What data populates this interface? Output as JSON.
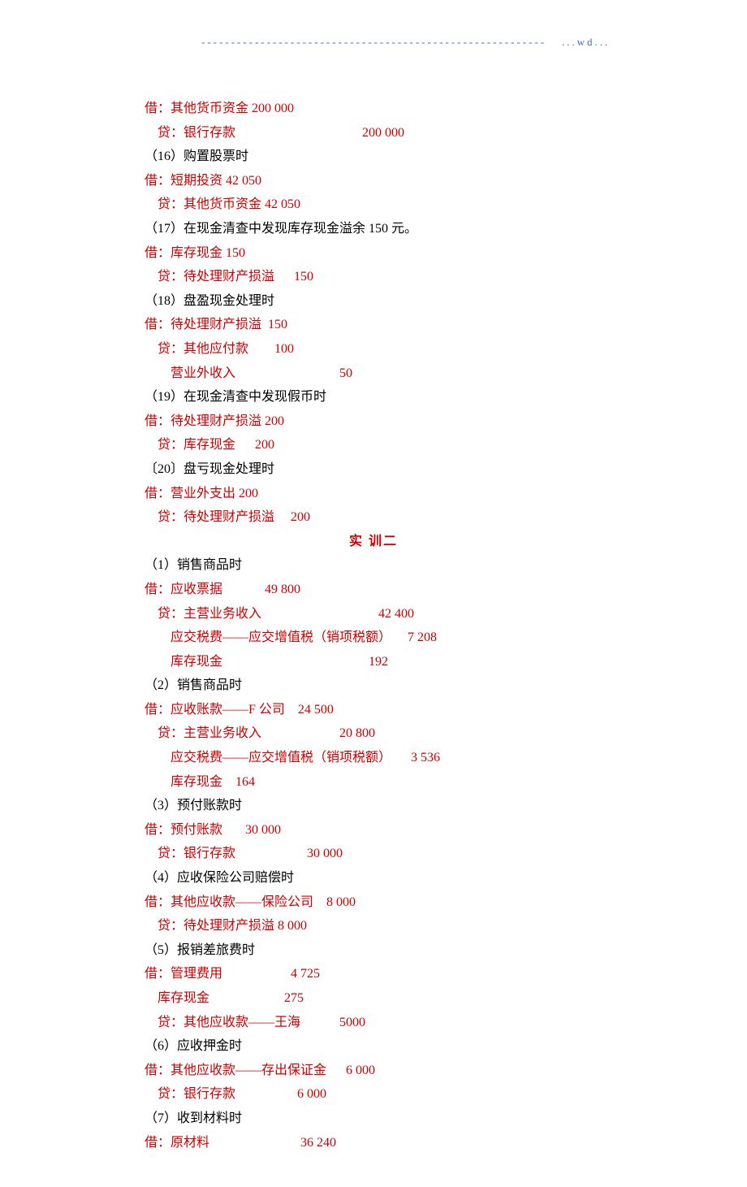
{
  "header": "----------------------------------------------------------   ...wd...",
  "lines": [
    {
      "cls": "line",
      "text": "借：其他货币资金 200 000"
    },
    {
      "cls": "line",
      "text": "    贷：银行存款                                       200 000"
    },
    {
      "cls": "line black",
      "text": "（16）购置股票时"
    },
    {
      "cls": "line",
      "text": "借：短期投资 42 050"
    },
    {
      "cls": "line",
      "text": "    贷：其他货币资金 42 050"
    },
    {
      "cls": "line black",
      "text": "（17）在现金清查中发现库存现金溢余 150 元。"
    },
    {
      "cls": "line",
      "text": "借：库存现金 150"
    },
    {
      "cls": "line",
      "text": "    贷：待处理财产损溢      150"
    },
    {
      "cls": "line black",
      "text": "（18）盘盈现金处理时"
    },
    {
      "cls": "line",
      "text": "借：待处理财产损溢  150"
    },
    {
      "cls": "line",
      "text": "    贷：其他应付款        100"
    },
    {
      "cls": "line",
      "text": "        营业外收入                                50"
    },
    {
      "cls": "line black",
      "text": "（19）在现金清查中发现假币时"
    },
    {
      "cls": "line",
      "text": "借：待处理财产损溢 200"
    },
    {
      "cls": "line",
      "text": "    贷：库存现金      200"
    },
    {
      "cls": "line black",
      "text": "〔20〕盘亏现金处理时"
    },
    {
      "cls": "line",
      "text": "借：营业外支出 200"
    },
    {
      "cls": "line",
      "text": "    贷：待处理财产损溢     200"
    },
    {
      "cls": "title-center",
      "text": "实   训二"
    },
    {
      "cls": "line black",
      "text": "（1）销售商品时"
    },
    {
      "cls": "line",
      "text": "借：应收票据             49 800"
    },
    {
      "cls": "line",
      "text": "    贷：主营业务收入                                    42 400"
    },
    {
      "cls": "line",
      "text": "        应交税费——应交增值税（销项税额）     7 208"
    },
    {
      "cls": "line",
      "text": "        库存现金                                             192"
    },
    {
      "cls": "line black",
      "text": "（2）销售商品时"
    },
    {
      "cls": "line",
      "text": "借：应收账款——F 公司    24 500"
    },
    {
      "cls": "line",
      "text": "    贷：主营业务收入                        20 800"
    },
    {
      "cls": "line",
      "text": "        应交税费——应交增值税（销项税额）      3 536"
    },
    {
      "cls": "line",
      "text": "        库存现金    164"
    },
    {
      "cls": "line black",
      "text": "（3）预付账款时"
    },
    {
      "cls": "line",
      "text": "借：预付账款       30 000"
    },
    {
      "cls": "line",
      "text": "    贷：银行存款                      30 000"
    },
    {
      "cls": "line black",
      "text": "（4）应收保险公司赔偿时"
    },
    {
      "cls": "line",
      "text": "借：其他应收款——保险公司    8 000"
    },
    {
      "cls": "line",
      "text": "    贷：待处理财产损溢 8 000"
    },
    {
      "cls": "line black",
      "text": "（5）报销差旅费时"
    },
    {
      "cls": "line",
      "text": "借：管理费用                     4 725"
    },
    {
      "cls": "line",
      "text": "    库存现金                       275"
    },
    {
      "cls": "line",
      "text": "    贷：其他应收款——王海            5000"
    },
    {
      "cls": "line black",
      "text": "（6）应收押金时"
    },
    {
      "cls": "line",
      "text": "借：其他应收款——存出保证金      6 000"
    },
    {
      "cls": "line",
      "text": "    贷：银行存款                   6 000"
    },
    {
      "cls": "line black",
      "text": "（7）收到材料时"
    },
    {
      "cls": "line",
      "text": "借：原材料                            36 240"
    }
  ]
}
